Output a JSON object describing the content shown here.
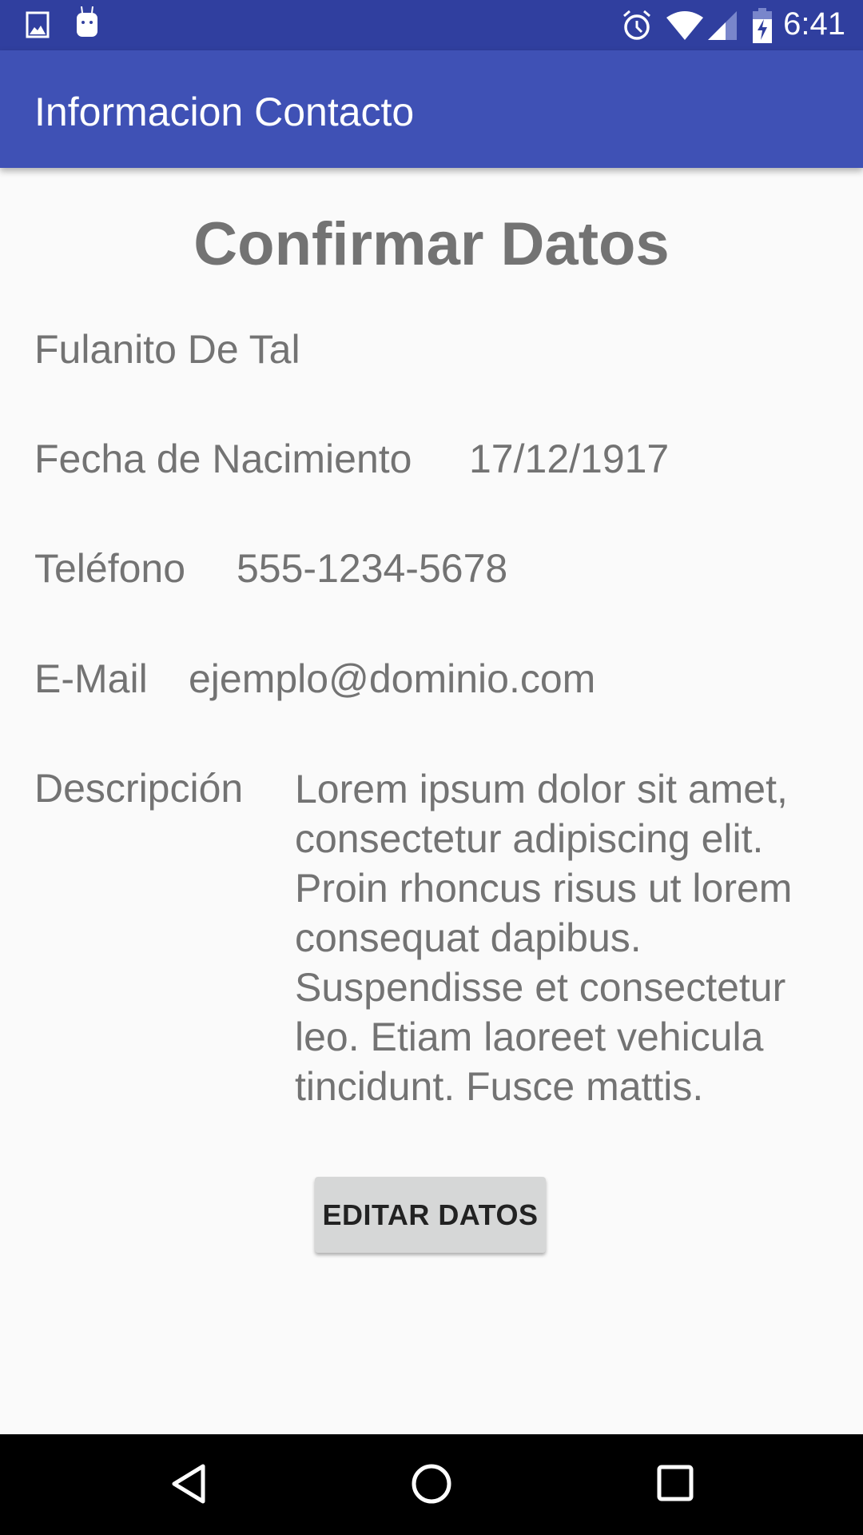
{
  "status_bar": {
    "time": "6:41",
    "icons": [
      "image-icon",
      "android-icon",
      "alarm-icon",
      "wifi-icon",
      "signal-icon",
      "battery-charging-icon"
    ]
  },
  "app_bar": {
    "title": "Informacion Contacto"
  },
  "main": {
    "heading": "Confirmar Datos",
    "name": "Fulanito De Tal",
    "fields": [
      {
        "label": "Fecha de Nacimiento",
        "value": "17/12/1917"
      },
      {
        "label": "Teléfono",
        "value": "555-1234-5678"
      },
      {
        "label": "E-Mail",
        "value": "ejemplo@dominio.com"
      },
      {
        "label": "Descripción",
        "value": "Lorem ipsum dolor sit amet, consectetur adipiscing elit. Proin rhoncus risus ut lorem consequat dapibus. Suspendisse et consectetur leo. Etiam laoreet vehicula tincidunt. Fusce mattis."
      }
    ],
    "edit_button": "EDITAR DATOS"
  },
  "colors": {
    "status_bar": "#303F9F",
    "app_bar": "#3F51B5",
    "text": "#737373",
    "button": "#D6D7D7"
  }
}
